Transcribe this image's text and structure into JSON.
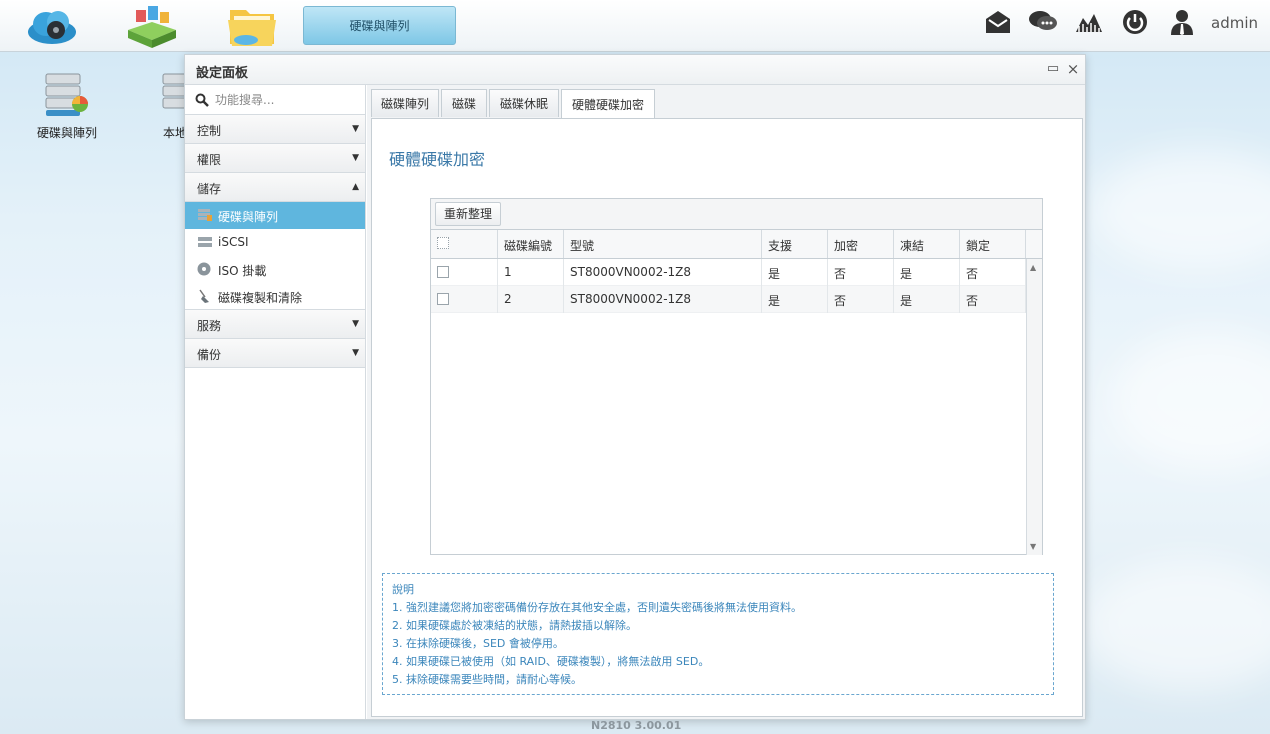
{
  "topbar": {
    "active_app": "硬碟與陣列",
    "user": "admin",
    "icons": [
      "cloud-drive-icon",
      "app-center-icon",
      "file-manager-icon",
      "mail-icon",
      "chat-icon",
      "mountain-icon",
      "power-icon",
      "user-icon"
    ]
  },
  "desktop": {
    "items": [
      {
        "label": "硬碟與陣列",
        "icon": "raid-storage-icon"
      },
      {
        "label": "本地",
        "icon": "local-storage-icon"
      }
    ]
  },
  "window": {
    "title": "設定面板",
    "search_placeholder": "功能搜尋...",
    "sidebar": {
      "categories": [
        {
          "label": "控制",
          "expanded": false
        },
        {
          "label": "權限",
          "expanded": false
        },
        {
          "label": "儲存",
          "expanded": true
        },
        {
          "label": "服務",
          "expanded": false
        },
        {
          "label": "備份",
          "expanded": false
        }
      ],
      "storage_items": [
        {
          "label": "硬碟與陣列",
          "icon": "disk-array-icon",
          "active": true
        },
        {
          "label": "iSCSI",
          "icon": "iscsi-icon",
          "active": false
        },
        {
          "label": "ISO 掛載",
          "icon": "iso-disc-icon",
          "active": false
        },
        {
          "label": "磁碟複製和清除",
          "icon": "broom-icon",
          "active": false
        }
      ]
    },
    "tabs": [
      {
        "label": "磁碟陣列",
        "active": false
      },
      {
        "label": "磁碟",
        "active": false
      },
      {
        "label": "磁碟休眠",
        "active": false
      },
      {
        "label": "硬體硬碟加密",
        "active": true
      }
    ],
    "panel_title": "硬體硬碟加密",
    "grid": {
      "refresh_label": "重新整理",
      "columns": [
        "磁碟編號",
        "型號",
        "支援",
        "加密",
        "凍結",
        "鎖定"
      ],
      "rows": [
        {
          "id": "1",
          "model": "ST8000VN0002-1Z8",
          "supported": "是",
          "encrypted": "否",
          "frozen": "是",
          "locked": "否"
        },
        {
          "id": "2",
          "model": "ST8000VN0002-1Z8",
          "supported": "是",
          "encrypted": "否",
          "frozen": "是",
          "locked": "否"
        }
      ]
    },
    "notes": {
      "title": "說明",
      "lines": [
        "1. 強烈建議您將加密密碼備份存放在其他安全處，否則遺失密碼後將無法使用資料。",
        "2. 如果硬碟處於被凍結的狀態，請熱拔插以解除。",
        "3. 在抹除硬碟後，SED 會被停用。",
        "4. 如果硬碟已被使用（如 RAID、硬碟複製），將無法啟用 SED。",
        "5. 抹除硬碟需要些時間，請耐心等候。"
      ]
    }
  },
  "footer": "N2810   3.00.01",
  "colors": {
    "accent": "#5fb6de",
    "title_blue": "#3b79a8",
    "note_blue": "#3b86bb"
  }
}
